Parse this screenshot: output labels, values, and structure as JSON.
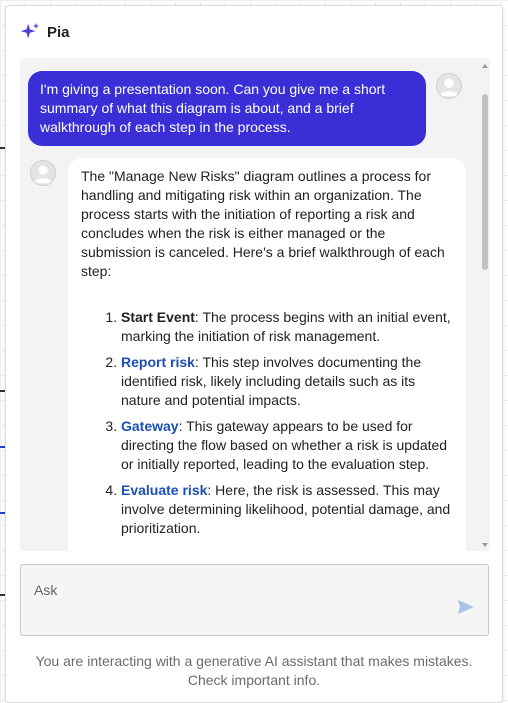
{
  "header": {
    "title": "Pia",
    "icon": "sparkle-icon",
    "icon_color": "#4a3fd6"
  },
  "chat": {
    "user_message": "I'm giving a presentation soon. Can you give me a short summary of what this diagram is about, and a brief walkthrough of each step in the process.",
    "user_bubble_color": "#3a2fd6",
    "ai_intro": "The \"Manage New Risks\" diagram outlines a process for handling and mitigating risk within an organization. The process starts with the initiation of reporting a risk and concludes when the risk is either managed or the submission is canceled. Here's a brief walkthrough of each step:",
    "steps": [
      {
        "number": "1.",
        "term": "Start Event",
        "linked": false,
        "text": ": The process begins with an initial event, marking the initiation of risk management."
      },
      {
        "number": "2.",
        "term": "Report risk",
        "linked": true,
        "text": ": This step involves documenting the identified risk, likely including details such as its nature and potential impacts."
      },
      {
        "number": "3.",
        "term": "Gateway",
        "linked": true,
        "text": ": This gateway appears to be used for directing the flow based on whether a risk is updated or initially reported, leading to the evaluation step."
      },
      {
        "number": "4.",
        "term": "Evaluate risk",
        "linked": true,
        "text": ": Here, the risk is assessed. This may involve determining likelihood, potential damage, and prioritization."
      }
    ],
    "link_color": "#1a4fb5"
  },
  "input": {
    "placeholder": "Ask",
    "value": "",
    "send_icon": "send-arrow-icon",
    "send_color": "#a9c4ea"
  },
  "disclaimer": "You are interacting with a generative AI assistant that makes mistakes. Check important info."
}
